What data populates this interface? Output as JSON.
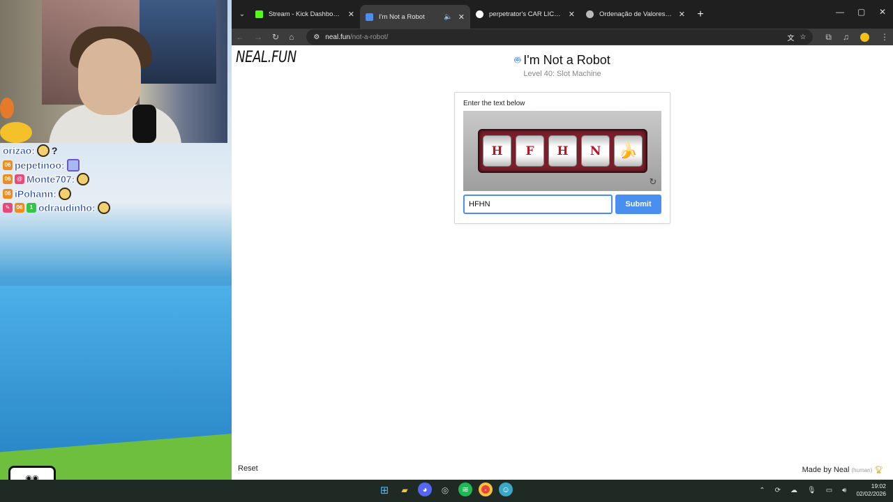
{
  "stream": {
    "chat": [
      {
        "user": "orizao:",
        "badges": [],
        "emotes": [
          "face",
          "?"
        ]
      },
      {
        "user": "pepetinoo:",
        "badges": [
          "06"
        ],
        "emotes": [
          "sq"
        ]
      },
      {
        "user": "Monte707:",
        "badges": [
          "06",
          "@"
        ],
        "emotes": [
          "face"
        ]
      },
      {
        "user": "iPohann:",
        "badges": [
          "06"
        ],
        "emotes": [
          "face"
        ]
      },
      {
        "user": "odraudinho:",
        "badges": [
          "pen",
          "06",
          "1"
        ],
        "emotes": [
          "face"
        ]
      }
    ]
  },
  "browser": {
    "tabs": [
      {
        "title": "Stream - Kick Dashboard",
        "favicon_color": "#53fc18",
        "active": false
      },
      {
        "title": "I'm Not a Robot",
        "favicon_color": "#4a8ef0",
        "active": true
      },
      {
        "title": "perpetrator's CAR LICENSE - Pe",
        "favicon_color": "#ffffff",
        "active": false
      },
      {
        "title": "Ordenação de Valores Matemát",
        "favicon_color": "#bbbbbb",
        "active": false
      }
    ],
    "address": {
      "domain": "neal.fun",
      "path": "/not-a-robot/"
    }
  },
  "page": {
    "logo": "NEAL.FUN",
    "title": "I'm Not a Robot",
    "subtitle": "Level 40: Slot Machine",
    "captcha": {
      "prompt": "Enter the text below",
      "reels": [
        "H",
        "F",
        "H",
        "N",
        "🍌"
      ],
      "input_value": "HFHN",
      "submit_label": "Submit"
    },
    "reset_label": "Reset",
    "made_by": "Made by Neal",
    "made_by_tag": "(human)"
  },
  "taskbar": {
    "time": "19:02",
    "date": "02/02/2026"
  },
  "colors": {
    "accent": "#4a8ef0",
    "slot_frame": "#7a1e2a",
    "reel_letter": "#b3182c"
  }
}
